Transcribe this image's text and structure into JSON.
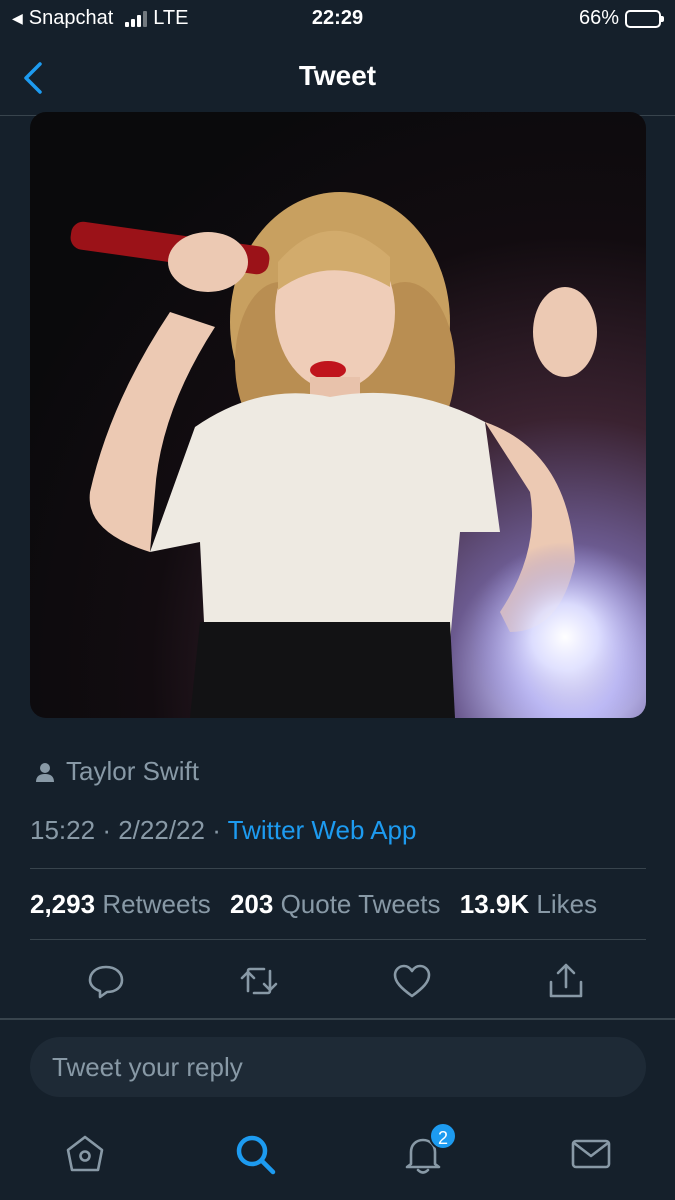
{
  "status_bar": {
    "back_app": "Snapchat",
    "network": "LTE",
    "time": "22:29",
    "battery": "66%",
    "battery_level": 0.66
  },
  "header": {
    "title": "Tweet"
  },
  "tweet": {
    "author": "Taylor Swift",
    "time": "15:22",
    "date": "2/22/22",
    "separator": "·",
    "source": "Twitter Web App",
    "stats": {
      "retweets_count": "2,293",
      "retweets_label": "Retweets",
      "quotes_count": "203",
      "quotes_label": "Quote Tweets",
      "likes_count": "13.9K",
      "likes_label": "Likes"
    }
  },
  "reply": {
    "placeholder": "Tweet your reply"
  },
  "tabs": {
    "notifications_badge": "2"
  },
  "colors": {
    "background": "#15202b",
    "accent": "#1d9bf0",
    "secondary_text": "#8899a6",
    "divider": "#38444d"
  }
}
